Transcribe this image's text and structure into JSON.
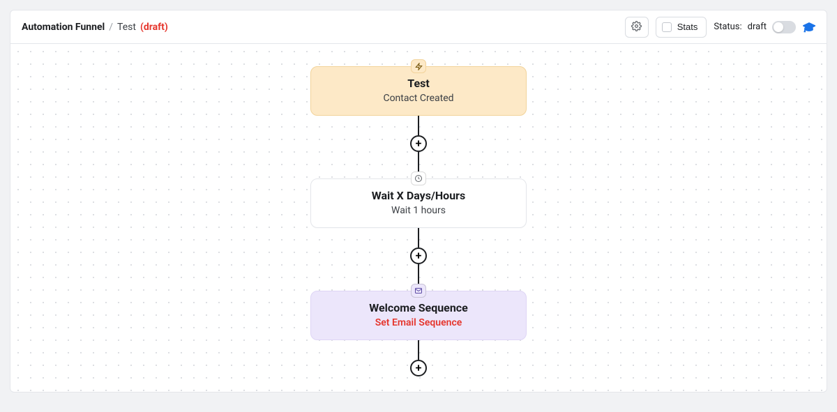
{
  "header": {
    "root_label": "Automation Funnel",
    "separator": "/",
    "funnel_name": "Test",
    "draft_tag": "(draft)"
  },
  "toolbar": {
    "stats_label": "Stats",
    "status_prefix": "Status:",
    "status_value": "draft"
  },
  "flow": {
    "nodes": [
      {
        "title": "Test",
        "subtitle": "Contact Created"
      },
      {
        "title": "Wait X Days/Hours",
        "subtitle": "Wait 1 hours"
      },
      {
        "title": "Welcome Sequence",
        "subtitle": "Set Email Sequence"
      }
    ],
    "add_label": "+"
  }
}
